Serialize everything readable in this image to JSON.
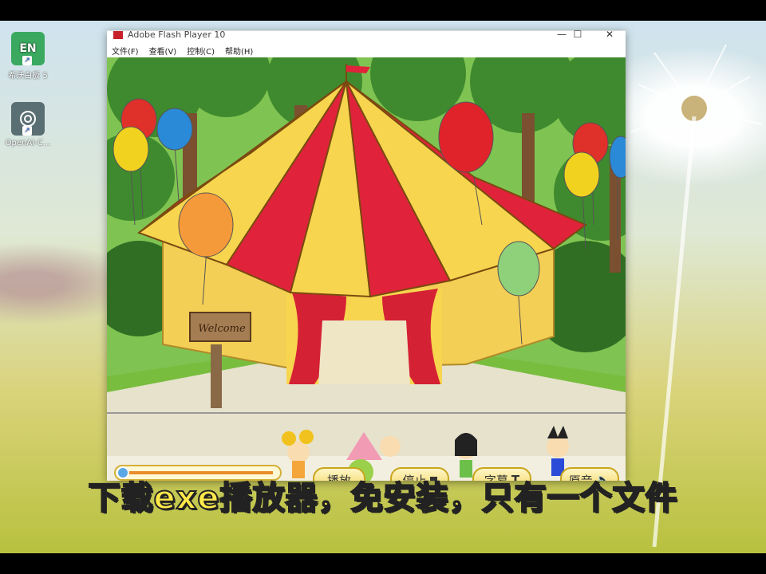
{
  "desktop": {
    "icons": [
      {
        "label": "希沃白板 5",
        "badge": "EN",
        "icon": "easinote-icon",
        "color": "#3aa95f"
      },
      {
        "label": "OpenAI-C...",
        "icon": "openai-icon",
        "color": "#5a6f73"
      }
    ]
  },
  "window": {
    "title": "Adobe Flash Player 10",
    "menu": [
      "文件(F)",
      "查看(V)",
      "控制(C)",
      "帮助(H)"
    ],
    "controls": {
      "minimize": "—",
      "maximize": "☐",
      "close": "✕"
    }
  },
  "stage": {
    "sign_text": "Welcome",
    "progress": 0.0,
    "buttons": {
      "play": "播放",
      "stop": "停止",
      "subtitles": "字幕",
      "audio": "原音"
    }
  },
  "colors": {
    "tent_red": "#e0233a",
    "tent_yellow": "#f7d54e",
    "accent_caption": "#ffe94a"
  },
  "caption": "下载exe播放器，免安装，只有一个文件"
}
